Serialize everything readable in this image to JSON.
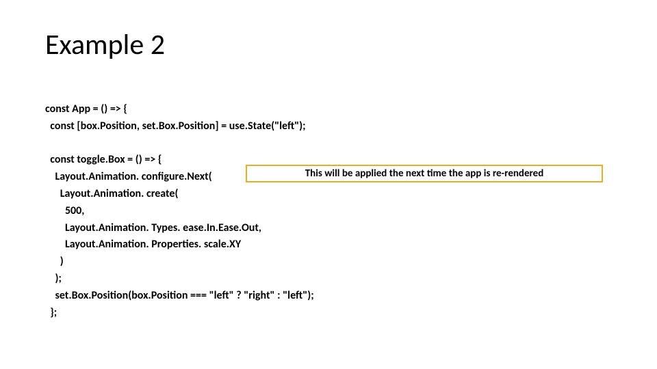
{
  "title": "Example 2",
  "code": {
    "l1": "const App = () => {",
    "l2": "  const [box.Position, set.Box.Position] = use.State(\"left\");",
    "l3": "",
    "l4": "  const toggle.Box = () => {",
    "l5": "    Layout.Animation. configure.Next(",
    "l6": "      Layout.Animation. create(",
    "l7": "        500,",
    "l8": "        Layout.Animation. Types. ease.In.Ease.Out,",
    "l9": "        Layout.Animation. Properties. scale.XY",
    "l10": "      )",
    "l11": "    );",
    "l12": "    set.Box.Position(box.Position === \"left\" ? \"right\" : \"left\");",
    "l13": "  };"
  },
  "annotation": "This will be applied the next time the app is re-rendered"
}
